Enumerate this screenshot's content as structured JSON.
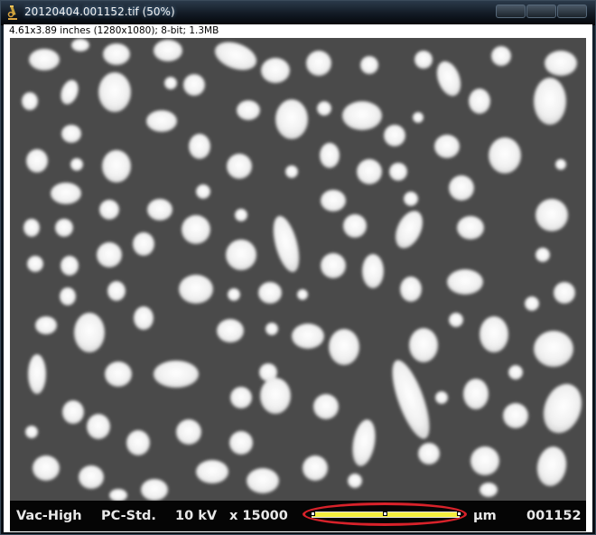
{
  "window": {
    "title": "20120404.001152.tif (50%)",
    "icon": "microscope-icon"
  },
  "info_bar": {
    "text": "4.61x3.89 inches (1280x1080); 8-bit; 1.3MB"
  },
  "image": {
    "description_tag": "sem-micrograph",
    "background_color": "#4a4a4a",
    "particle_color": "#f2f2f2"
  },
  "data_bar": {
    "vacuum": "Vac-High",
    "detector": "PC-Std.",
    "voltage": "10 kV",
    "magnification": "x 15000",
    "scale_unit": "μm",
    "image_number": "001152",
    "scale_bar_color": "#f4ee3e",
    "highlight_color": "#d8222a"
  }
}
